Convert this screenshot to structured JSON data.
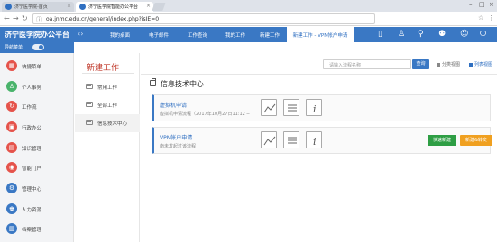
{
  "browser": {
    "tabs": [
      {
        "label": "济宁医学院-首页"
      },
      {
        "label": "济宁医学院智能办公平台"
      }
    ],
    "url": "oa.jnmc.edu.cn/general/index.php?isIE=0"
  },
  "app": {
    "logo": "济宁医学院办公平台",
    "nav_toggle_label": "导航菜单",
    "main_nav": [
      {
        "label": "我的桌面"
      },
      {
        "label": "电子邮件"
      },
      {
        "label": "工作查询"
      },
      {
        "label": "我的工作"
      },
      {
        "label": "新建工作"
      },
      {
        "label": "新建工作 - VPN帐户申请"
      }
    ]
  },
  "sidebar": {
    "items": [
      {
        "label": "快捷菜单",
        "icon": "grid-icon",
        "color": "#e5534b"
      },
      {
        "label": "个人事务",
        "icon": "person-icon",
        "color": "#49b36b"
      },
      {
        "label": "工作流",
        "icon": "flow-icon",
        "color": "#e5534b"
      },
      {
        "label": "行政办公",
        "icon": "briefcase-icon",
        "color": "#e5534b"
      },
      {
        "label": "知识管理",
        "icon": "book-icon",
        "color": "#e5534b"
      },
      {
        "label": "智能门户",
        "icon": "portal-icon",
        "color": "#e5534b"
      },
      {
        "label": "管理中心",
        "icon": "gear-icon",
        "color": "#3a78c4"
      },
      {
        "label": "人力资源",
        "icon": "people-icon",
        "color": "#3a78c4"
      },
      {
        "label": "档案管理",
        "icon": "archive-icon",
        "color": "#3a78c4"
      }
    ]
  },
  "subnav": {
    "title": "新建工作",
    "items": [
      {
        "label": "常用工作"
      },
      {
        "label": "全部工作"
      },
      {
        "label": "信息技术中心"
      }
    ]
  },
  "main": {
    "search_placeholder": "请输入流程名称",
    "search_button": "查询",
    "views": [
      {
        "label": "分类视图"
      },
      {
        "label": "列表视图"
      }
    ],
    "section_title": "信息技术中心",
    "cards": [
      {
        "title": "虚拟机申请",
        "desc": "虚拟机申请流程（2017年10月27日11:12 ─",
        "buttons": []
      },
      {
        "title": "VPN帐户申请",
        "desc": "南未发起过该流程",
        "buttons": [
          {
            "label": "快速新建"
          },
          {
            "label": "新建&转交"
          }
        ]
      }
    ]
  },
  "colors": {
    "accent": "#3a78c4",
    "title_red": "#c0392b",
    "green": "#2e9e44",
    "orange": "#f0a020"
  }
}
